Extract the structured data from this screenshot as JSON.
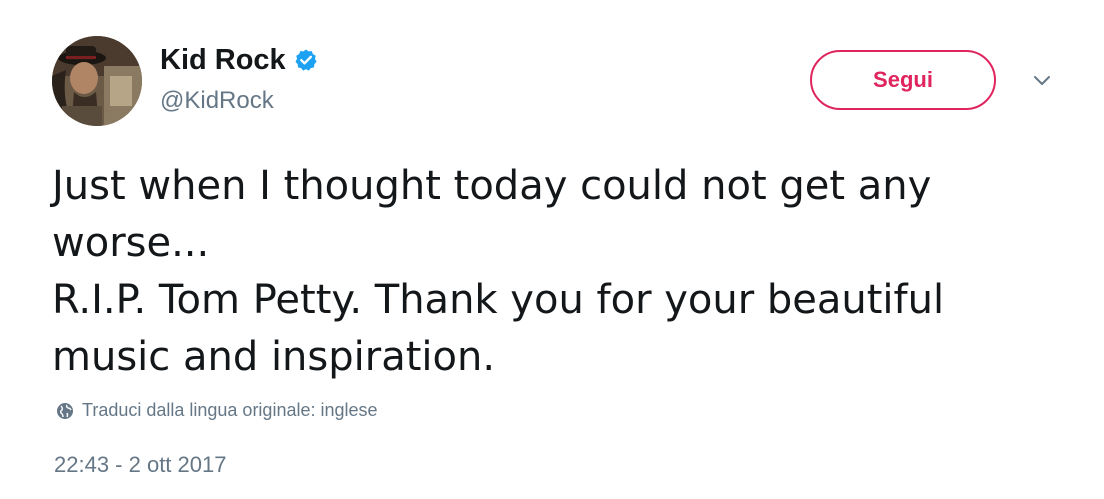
{
  "author": {
    "display_name": "Kid Rock",
    "handle": "@KidRock",
    "verified": true,
    "avatar_icon": "avatar-portrait"
  },
  "actions": {
    "follow_label": "Segui",
    "menu_icon": "chevron-down-icon"
  },
  "tweet": {
    "text": "Just when I thought today could not get any\nworse...\nR.I.P. Tom Petty. Thank you for your beautiful\nmusic and inspiration.",
    "translate_label": "Traduci dalla lingua originale: inglese",
    "translate_icon": "globe-icon",
    "timestamp": "22:43 - 2 ott 2017"
  },
  "colors": {
    "accent": "#e0245e",
    "verified": "#1da1f2",
    "muted_text": "#657786",
    "body_text": "#14171a"
  }
}
